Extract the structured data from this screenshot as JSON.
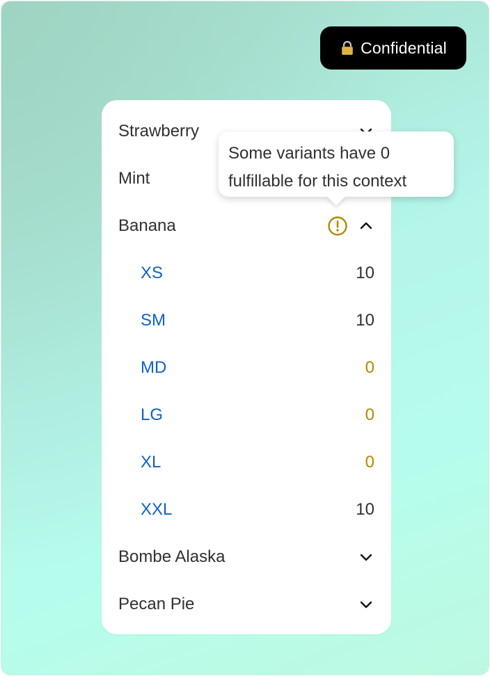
{
  "badge": {
    "label": "Confidential",
    "icon": "lock-icon"
  },
  "tooltip": {
    "line1": "Some variants have 0",
    "line2": "fulfillable for this context"
  },
  "products": [
    {
      "name": "Strawberry",
      "expanded": false
    },
    {
      "name": "Mint",
      "expanded": false
    },
    {
      "name": "Banana",
      "expanded": true,
      "warning": true
    },
    {
      "name": "Bombe Alaska",
      "expanded": false
    },
    {
      "name": "Pecan Pie",
      "expanded": false
    }
  ],
  "variants": [
    {
      "size": "XS",
      "qty": "10"
    },
    {
      "size": "SM",
      "qty": "10"
    },
    {
      "size": "MD",
      "qty": "0"
    },
    {
      "size": "LG",
      "qty": "0"
    },
    {
      "size": "XL",
      "qty": "0"
    },
    {
      "size": "XXL",
      "qty": "10"
    }
  ],
  "colors": {
    "link": "#0f61c8",
    "warning": "#b08a00",
    "text": "#303030",
    "badge_bg": "#000000"
  }
}
